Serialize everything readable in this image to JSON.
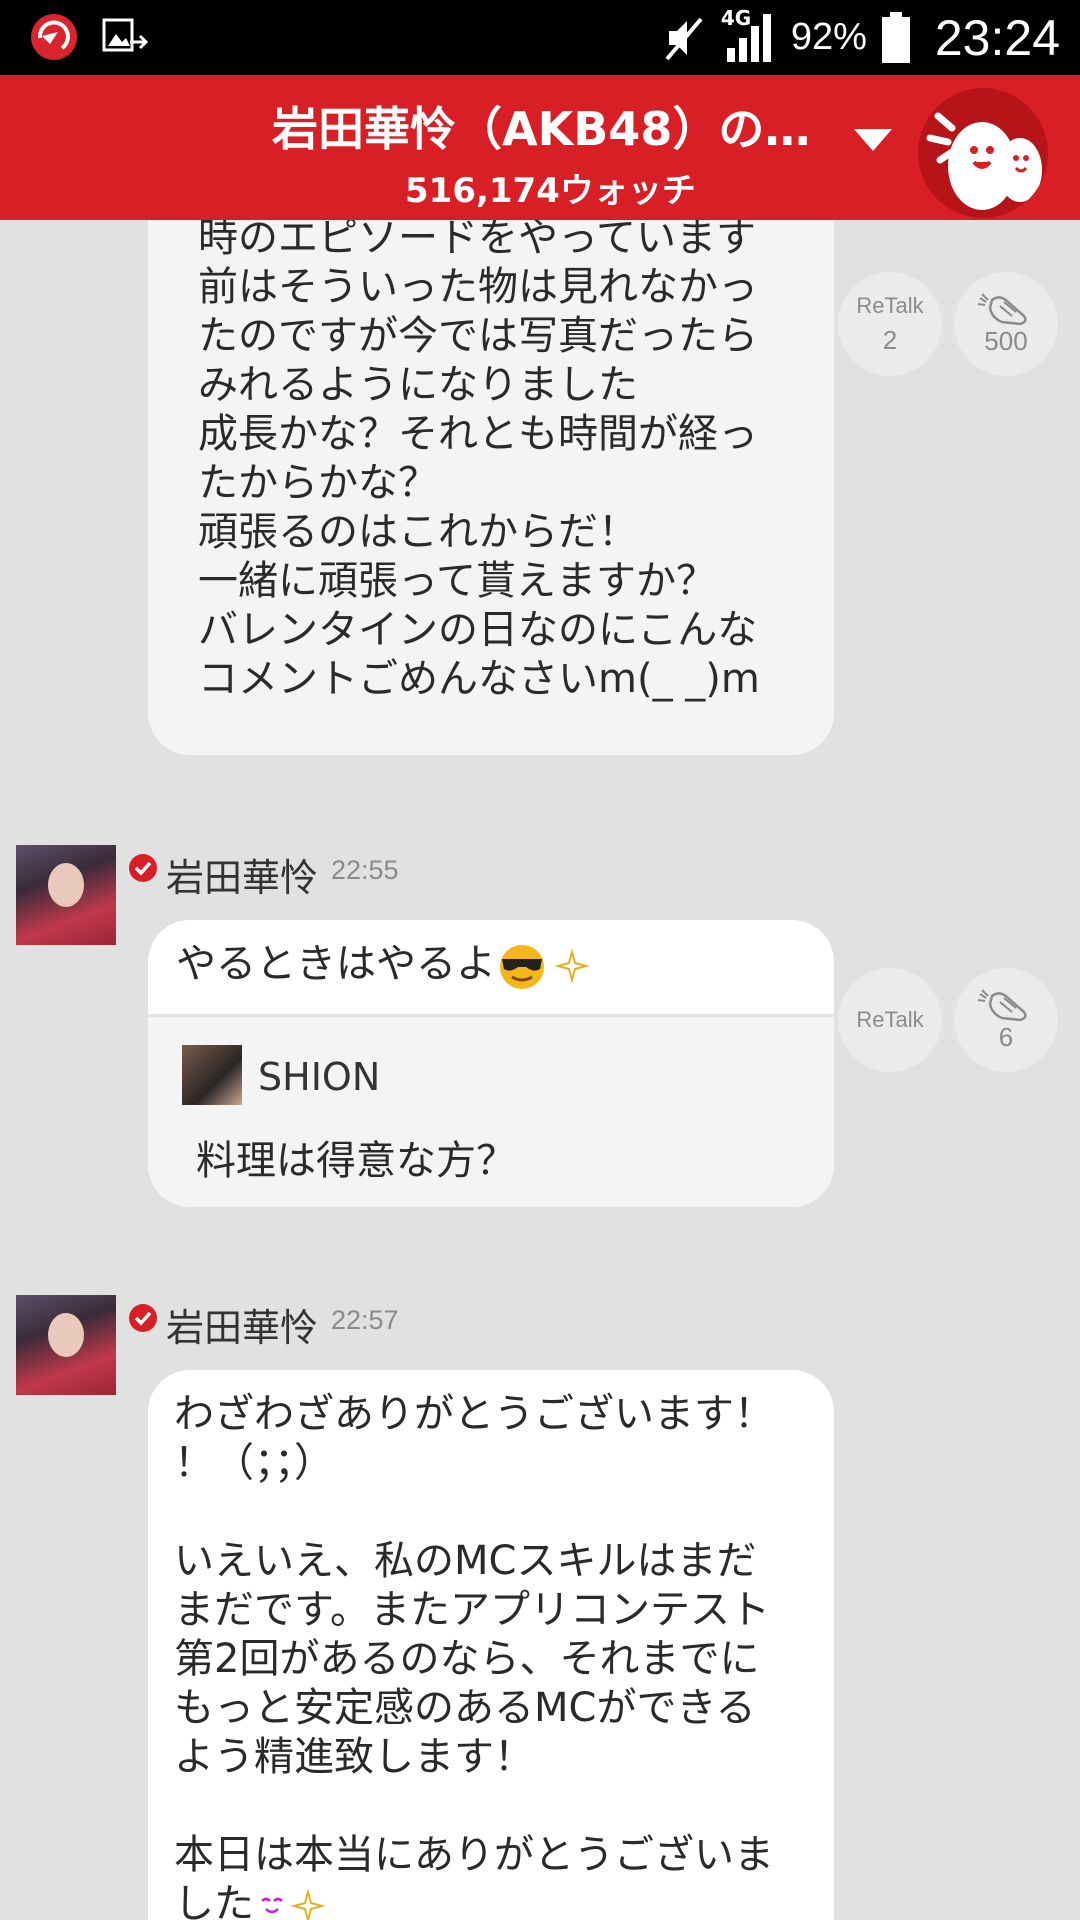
{
  "status_bar": {
    "network": "4G",
    "battery": "92%",
    "time": "23:24"
  },
  "header": {
    "title": "岩田華怜（AKB48）の…",
    "watch_count": "516,174ウォッチ",
    "dropdown_icon": "chevron-down-icon",
    "mascot_icon": "mascot-icon"
  },
  "messages": [
    {
      "text": "時のエピソードをやっています\n前はそういった物は見れなかっ\nたのですが今では写真だったら\nみれるようになりました\n成長かな？それとも時間が経っ\nたからかな？\n頑張るのはこれからだ！\n一緒に頑張って貰えますか？\nバレンタインの日なのにこんな\nコメントごめんなさいm(_ _)m",
      "retalk_label": "ReTalk",
      "retalk_count": "2",
      "clap_count": "500"
    },
    {
      "user": "岩田華怜",
      "time": "22:55",
      "text": "やるときはやるよ",
      "quote_user": "SHION",
      "quote_text": "料理は得意な方？",
      "retalk_label": "ReTalk",
      "clap_count": "6"
    },
    {
      "user": "岩田華怜",
      "time": "22:57",
      "text": "わざわざありがとうございます！\n！（；；）\n\nいえいえ、私のMCスキルはまだ\nまだです。またアプリコンテスト\n第2回があるのなら、それまでに\nもっと安定感のあるMCができる\nよう精進致します！\n\n本日は本当にありがとうございま\nした"
    }
  ],
  "colors": {
    "header_red": "#d91f26",
    "background": "#e1e1e1",
    "verified_red": "#d91f26"
  }
}
